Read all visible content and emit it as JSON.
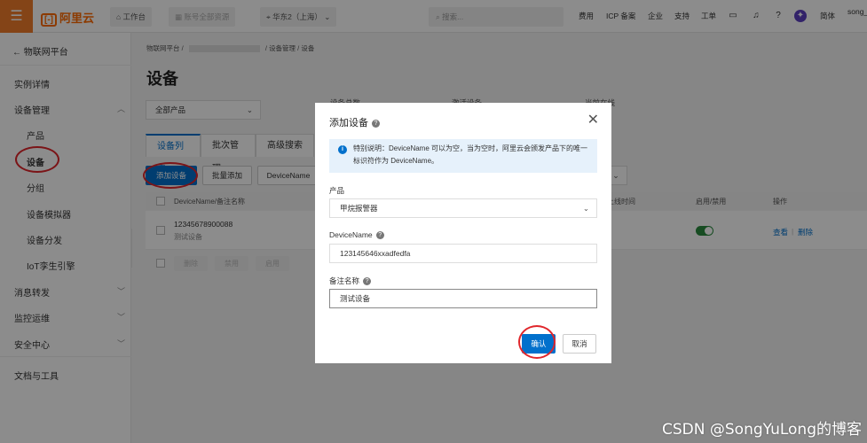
{
  "topbar": {
    "menu_icon": "menu-icon",
    "logo_text": "阿里云",
    "logo_bracket": "[-]",
    "workbench": "工作台",
    "account": "账号全部资源",
    "region": "华东2（上海）",
    "search_placeholder": "搜索...",
    "links": [
      "费用",
      "ICP 备案",
      "企业",
      "支持",
      "工单"
    ],
    "lang": "简体",
    "user": "song_"
  },
  "sidebar": {
    "back_label": "物联网平台",
    "items": [
      {
        "label": "实例详情"
      },
      {
        "label": "设备管理"
      },
      {
        "label": "产品"
      },
      {
        "label": "设备"
      },
      {
        "label": "分组"
      },
      {
        "label": "设备模拟器"
      },
      {
        "label": "设备分发"
      },
      {
        "label": "IoT孪生引擎"
      },
      {
        "label": "消息转发"
      },
      {
        "label": "监控运维"
      },
      {
        "label": "安全中心"
      },
      {
        "label": "文档与工具"
      }
    ]
  },
  "main": {
    "breadcrumb": {
      "root": "物联网平台",
      "sep": "/",
      "section": "设备管理",
      "current": "设备"
    },
    "title": "设备",
    "product_select": "全部产品",
    "stats": [
      "设备总数",
      "激活设备",
      "当前在线"
    ],
    "tabs": [
      "设备列表",
      "批次管理",
      "高级搜索"
    ],
    "buttons": {
      "add": "添加设备",
      "batch_add": "批量添加",
      "filter": "DeviceName"
    },
    "table": {
      "headers": [
        "DeviceName/备注名称",
        "上线时间",
        "启用/禁用",
        "操作"
      ],
      "row": {
        "device_name": "12345678900088",
        "remark": "测试设备",
        "enabled": true,
        "view": "查看",
        "delete": "删除"
      }
    },
    "bulk": [
      "删除",
      "禁用",
      "启用"
    ]
  },
  "modal": {
    "title": "添加设备",
    "note": "特别说明：DeviceName 可以为空，当为空时，阿里云会颁发产品下的唯一标识符作为 DeviceName。",
    "product_label": "产品",
    "product_value": "甲烷报警器",
    "devicename_label": "DeviceName",
    "devicename_value": "123145646xxadfedfa",
    "remark_label": "备注名称",
    "remark_value": "测试设备",
    "confirm": "确认",
    "cancel": "取消"
  },
  "watermark": "CSDN @SongYuLong的博客",
  "colors": {
    "brand": "#ff6a00",
    "primary": "#0070cc",
    "annotation": "#e0262b",
    "toggle_on": "#2b8a3e"
  }
}
